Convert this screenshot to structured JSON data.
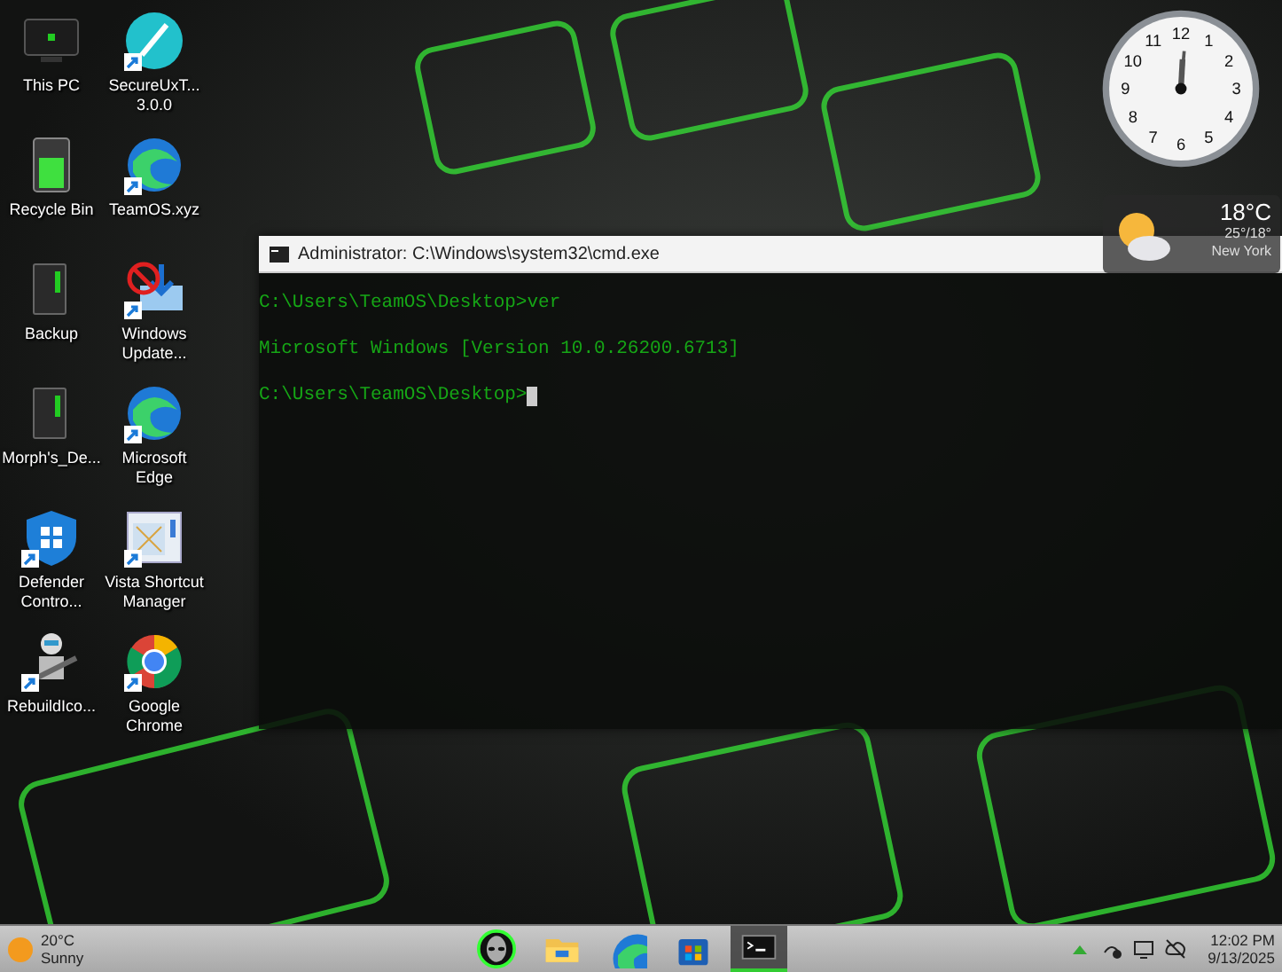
{
  "desktop_icons": [
    {
      "label": "This PC",
      "kind": "monitor",
      "shortcut": false
    },
    {
      "label": "SecureUxT... 3.0.0",
      "kind": "brush",
      "shortcut": true
    },
    {
      "label": "Recycle Bin",
      "kind": "bin",
      "shortcut": false
    },
    {
      "label": "TeamOS.xyz",
      "kind": "edge",
      "shortcut": true
    },
    {
      "label": "Backup",
      "kind": "tower",
      "shortcut": false
    },
    {
      "label": "Windows Update...",
      "kind": "blocked",
      "shortcut": true
    },
    {
      "label": "Morph's_De...",
      "kind": "tower",
      "shortcut": false
    },
    {
      "label": "Microsoft Edge",
      "kind": "edge",
      "shortcut": true
    },
    {
      "label": "Defender Contro...",
      "kind": "shield",
      "shortcut": true
    },
    {
      "label": "Vista Shortcut Manager",
      "kind": "window",
      "shortcut": true
    },
    {
      "label": "RebuildIco...",
      "kind": "robot",
      "shortcut": true
    },
    {
      "label": "Google Chrome",
      "kind": "chrome",
      "shortcut": true
    }
  ],
  "clock": {
    "numerals": [
      "12",
      "11",
      "1",
      "10",
      "2",
      "9",
      "3",
      "8",
      "4",
      "7",
      "5",
      "6"
    ]
  },
  "weather_gadget": {
    "temperature": "18°C",
    "range": "25°/18°",
    "city": "New York"
  },
  "cmd_window": {
    "title": "Administrator: C:\\Windows\\system32\\cmd.exe",
    "lines": [
      "C:\\Users\\TeamOS\\Desktop>ver",
      "Microsoft Windows [Version 10.0.26200.6713]",
      "C:\\Users\\TeamOS\\Desktop>"
    ],
    "cursor": true
  },
  "taskbar": {
    "weather": {
      "temperature": "20°C",
      "condition": "Sunny"
    },
    "apps": [
      {
        "kind": "alien",
        "active": false
      },
      {
        "kind": "folder",
        "active": false
      },
      {
        "kind": "edge",
        "active": false
      },
      {
        "kind": "store",
        "active": false
      },
      {
        "kind": "terminal",
        "active": true
      }
    ],
    "time": "12:02 PM",
    "date": "9/13/2025"
  }
}
